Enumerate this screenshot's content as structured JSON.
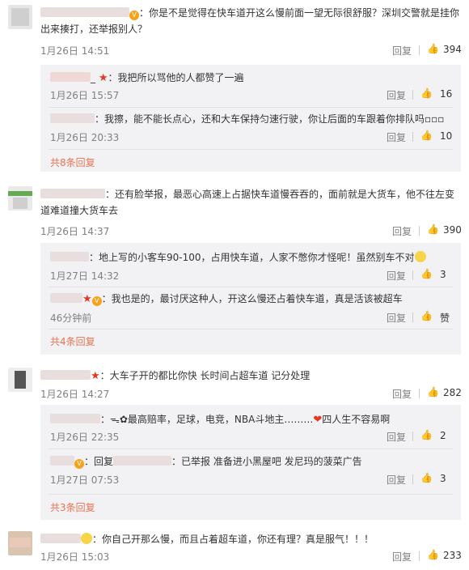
{
  "comments": [
    {
      "text": "：你是不是觉得在快车道开这么慢前面一望无际很舒服？深圳交警就是挂你出来揍打，还举报别人？",
      "time": "1月26日 14:51",
      "reply_label": "回复",
      "likes": "394",
      "replies": [
        {
          "text": "：我把所以骂他的人都赞了一遍",
          "time": "1月26日 15:57",
          "reply_label": "回复",
          "likes": "16"
        },
        {
          "text": "：我擦，能不能长点心，还和大车保持匀速行驶，你让后面的车跟着你排队吗▫▫▫",
          "time": "1月26日 20:33",
          "reply_label": "回复",
          "likes": "10"
        }
      ],
      "more": "共8条回复"
    },
    {
      "text": "：还有脸举报，最恶心高速上占据快车道慢吞吞的，面前就是大货车，他不往左变道难道撞大货车去",
      "time": "1月26日 14:37",
      "reply_label": "回复",
      "likes": "390",
      "replies": [
        {
          "text": "：地上写的小客车90-100，占用快车道，人家不憋你才怪呢！虽然别车不对",
          "time": "1月27日 14:32",
          "reply_label": "回复",
          "likes": "3"
        },
        {
          "text": "：我也是的，最讨厌这种人，开这么慢还占着快车道，真是活该被超车",
          "time": "46分钟前",
          "reply_label": "回复",
          "likes": "赞"
        }
      ],
      "more": "共4条回复"
    },
    {
      "text": "：大车子开的都比你快 长时间占超车道 记分处理",
      "time": "1月26日 14:27",
      "reply_label": "回复",
      "likes": "282",
      "replies": [
        {
          "text_a": "：",
          "text_b": "最高赔率，足球，电竞，NBA斗地主………",
          "text_c": "四人生不容易啊",
          "time": "1月26日 22:35",
          "reply_label": "回复",
          "likes": "2"
        },
        {
          "text_a": "：回复",
          "text_b": "：已举报 准备进小黑屋吧 发尼玛的菠菜广告",
          "time": "1月27日 07:53",
          "reply_label": "回复",
          "likes": "3"
        }
      ],
      "more": "共3条回复"
    },
    {
      "text": "：你自己开那么慢，而且占着超车道，你还有理？真是服气！！！",
      "time": "1月26日 15:03",
      "reply_label": "回复",
      "likes": "233"
    }
  ],
  "icons": {
    "like": "thumbs-up-icon",
    "vip": "vip-badge-icon",
    "star": "star-badge-icon"
  },
  "colors": {
    "more_link": "#eb7350",
    "time": "#808080",
    "reply_bg": "#f2f2f5"
  }
}
